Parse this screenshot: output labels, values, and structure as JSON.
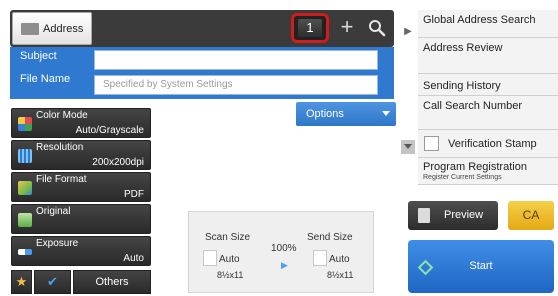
{
  "header": {
    "address_label": "Address",
    "address_count": "1",
    "plus_symbol": "+"
  },
  "fields": {
    "subject_label": "Subject",
    "subject_value": "",
    "filename_label": "File Name",
    "filename_placeholder": "Specified by System Settings"
  },
  "options_tab": {
    "label": "Options"
  },
  "settings": [
    {
      "title": "Color Mode",
      "value": "Auto/Grayscale",
      "icon": "color-mode-icon"
    },
    {
      "title": "Resolution",
      "value": "200x200dpi",
      "icon": "resolution-icon"
    },
    {
      "title": "File Format",
      "value": "PDF",
      "icon": "file-format-icon"
    },
    {
      "title": "Original",
      "value": "",
      "icon": "original-icon"
    },
    {
      "title": "Exposure",
      "value": "Auto",
      "icon": "exposure-icon"
    }
  ],
  "bottom_buttons": {
    "star_glyph": "★",
    "check_glyph": "✔",
    "others_label": "Others"
  },
  "scan_panel": {
    "scan_size_label": "Scan Size",
    "scan_size_value": "Auto",
    "scan_size_paper": "8½x11",
    "ratio": "100%",
    "send_size_label": "Send Size",
    "send_size_value": "Auto",
    "send_size_paper": "8½x11"
  },
  "right_menu": {
    "items": [
      {
        "label": "Global Address Search"
      },
      {
        "label": "Address Review"
      },
      {
        "label": "Sending History"
      },
      {
        "label": "Call Search Number"
      }
    ],
    "verification_stamp": "Verification Stamp",
    "program_registration": "Program Registration",
    "program_registration_sub": "Register Current Settings"
  },
  "actions": {
    "preview_label": "Preview",
    "ca_label": "CA",
    "start_label": "Start"
  },
  "colors": {
    "accent_blue": "#2f7ad0",
    "highlight_red": "#d01c1c",
    "ca_yellow": "#e4a814",
    "start_blue": "#1f66c4"
  }
}
